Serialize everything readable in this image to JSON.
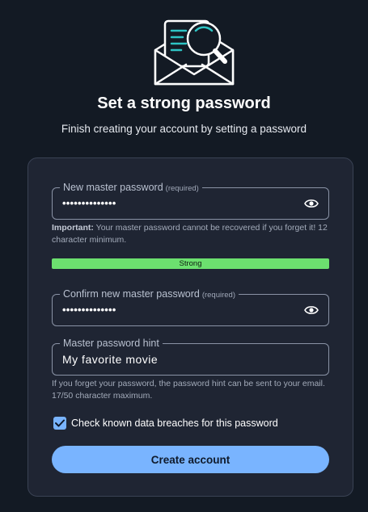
{
  "header": {
    "title": "Set a strong password",
    "subtitle": "Finish creating your account by setting a password"
  },
  "form": {
    "new_password": {
      "label": "New master password",
      "required_tag": "(required)",
      "value": "••••••••••••••",
      "toggle_icon": "eye-icon"
    },
    "important_note": {
      "strong": "Important:",
      "text": " Your master password cannot be recovered if you forget it! 12 character minimum."
    },
    "strength": {
      "label": "Strong",
      "color": "#6ce06f",
      "level": 1.0
    },
    "confirm_password": {
      "label": "Confirm new master password",
      "required_tag": "(required)",
      "value": "••••••••••••••",
      "toggle_icon": "eye-icon"
    },
    "hint": {
      "label": "Master password hint",
      "value": "My favorite movie"
    },
    "hint_note": "If you forget your password, the password hint can be sent to your email. 17/50 character maximum.",
    "breach_check": {
      "label": "Check known data breaches for this password",
      "checked": true
    },
    "submit_label": "Create account"
  },
  "colors": {
    "background": "#131a24",
    "card": "#1f2533",
    "accent": "#79b4ff",
    "strength": "#6ce06f",
    "icon_accent": "#2ec4c4"
  }
}
